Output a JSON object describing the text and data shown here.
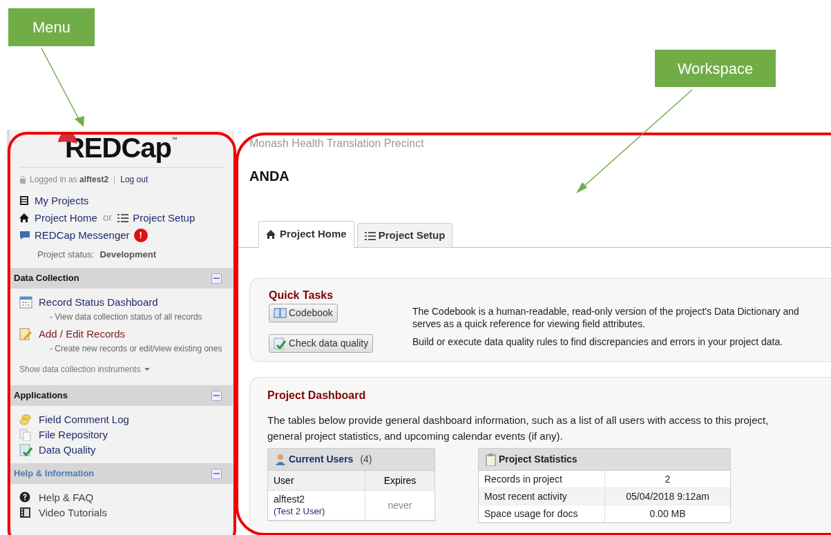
{
  "annotations": [
    {
      "label": "Menu"
    },
    {
      "label": "Workspace"
    }
  ],
  "sidebar": {
    "logo": "REDCap",
    "trademark": "™",
    "logged_in_text": "Logged in as",
    "username": "alftest2",
    "separator": "|",
    "logout": "Log out",
    "nav": [
      {
        "label": "My Projects"
      },
      {
        "label": "Project Home",
        "joiner": "or"
      },
      {
        "label": "Project Setup"
      },
      {
        "label": "REDCap Messenger",
        "alert": "!"
      }
    ],
    "status_label": "Project status:",
    "status_value": "Development",
    "sections": [
      {
        "title": "Data Collection",
        "kind": "plain",
        "expanded": true,
        "items": [
          {
            "label": "Record Status Dashboard",
            "description": "- View data collection status of all records",
            "color": "#1f2a6b"
          },
          {
            "label": "Add / Edit Records",
            "description": "- Create new records or edit/view existing ones",
            "color": "#7a1d1d"
          }
        ],
        "toggle_link": "Show data collection instruments"
      },
      {
        "title": "Applications",
        "kind": "plain",
        "expanded": true,
        "items": [
          {
            "label": "Field Comment Log",
            "color": "#1f2a6b"
          },
          {
            "label": "File Repository",
            "color": "#1f2a6b"
          },
          {
            "label": "Data Quality",
            "color": "#1f2a6b"
          }
        ]
      },
      {
        "title": "Help & Information",
        "kind": "link",
        "expanded": true,
        "items": [
          {
            "label": "Help & FAQ",
            "color": "#444444"
          },
          {
            "label": "Video Tutorials",
            "color": "#444444"
          }
        ]
      }
    ]
  },
  "main": {
    "institution": "Monash Health Translation Precinct",
    "project_title": "ANDA",
    "tabs": [
      {
        "label": "Project Home",
        "selected": true
      },
      {
        "label": "Project Setup",
        "selected": false
      }
    ],
    "quick_tasks": {
      "title": "Quick Tasks",
      "tasks": [
        {
          "button": "Codebook",
          "description": "The Codebook is a human-readable, read-only version of the project's Data Dictionary and serves as a quick reference for viewing field attributes."
        },
        {
          "button": "Check data quality",
          "description": "Build or execute data quality rules to find discrepancies and errors in your project data."
        }
      ]
    },
    "dashboard": {
      "title": "Project Dashboard",
      "intro": "The tables below provide general dashboard information, such as a list of all users with access to this project, general project statistics, and upcoming calendar events (if any).",
      "users": {
        "title": "Current Users",
        "count": "(4)",
        "columns": [
          "User",
          "Expires"
        ],
        "rows": [
          {
            "user": "alftest2",
            "full_name": "(Test 2 User)",
            "expires": "never"
          }
        ]
      },
      "statistics": {
        "title": "Project Statistics",
        "rows": [
          {
            "label": "Records in project",
            "value": "2"
          },
          {
            "label": "Most recent activity",
            "value": "05/04/2018 9:12am"
          },
          {
            "label": "Space usage for docs",
            "value": "0.00 MB"
          }
        ]
      }
    }
  }
}
